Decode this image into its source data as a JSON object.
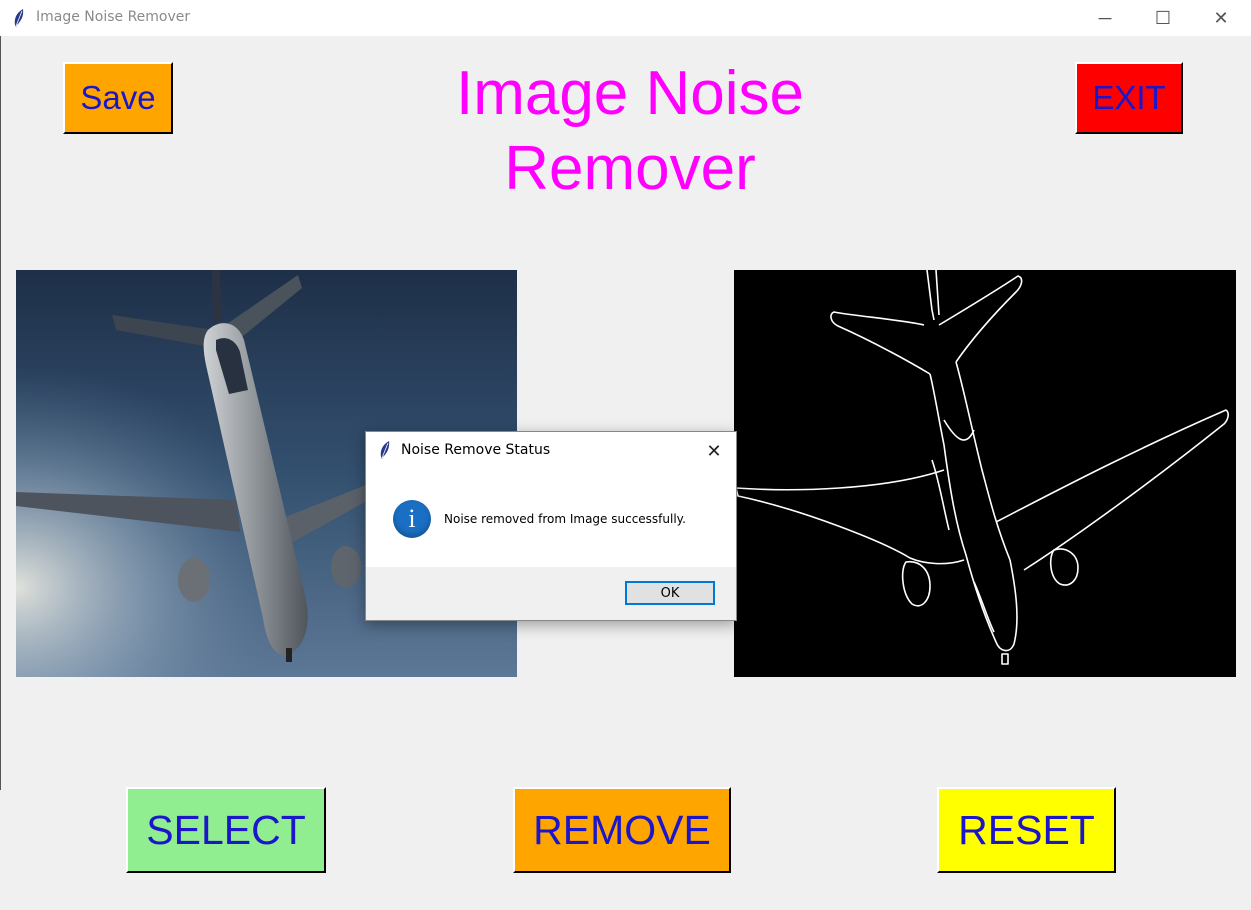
{
  "window": {
    "title": "Image Noise Remover",
    "icon": "feather-icon"
  },
  "window_controls": {
    "minimize": "─",
    "maximize": "☐",
    "close": "✕"
  },
  "app": {
    "heading_line1": "Image Noise",
    "heading_line2": "Remover",
    "heading_color": "#ff00ff",
    "save_label": "Save",
    "exit_label": "EXIT",
    "select_label": "SELECT",
    "remove_label": "REMOVE",
    "reset_label": "RESET"
  },
  "colors": {
    "button_text": "#1b16c9",
    "save_bg": "#ffa500",
    "exit_bg": "#ff0000",
    "select_bg": "#90ee90",
    "remove_bg": "#ffa500",
    "reset_bg": "#ffff00"
  },
  "images": {
    "original": "airplane-photo",
    "processed": "airplane-edge-outline"
  },
  "dialog": {
    "title": "Noise Remove Status",
    "message": "Noise removed from Image successfully.",
    "ok_label": "OK",
    "icon": "info-icon",
    "close": "✕"
  }
}
